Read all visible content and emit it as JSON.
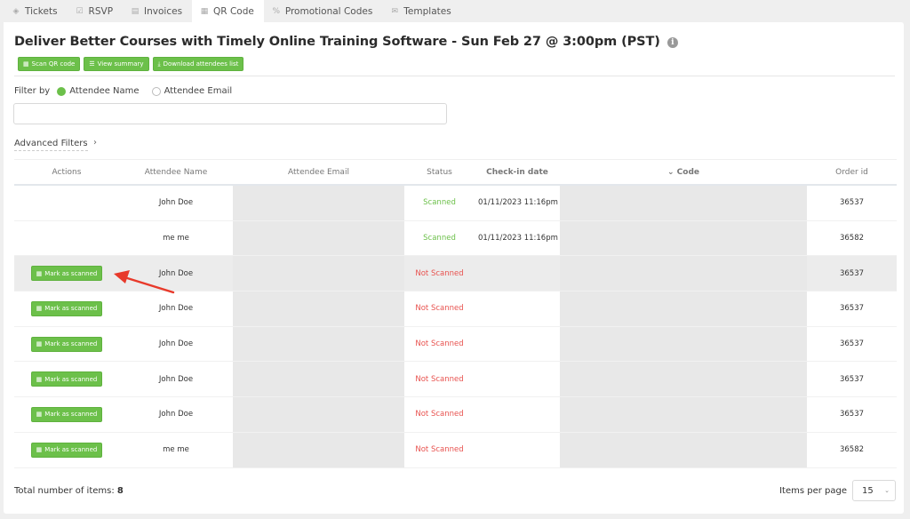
{
  "tabs": [
    {
      "label": "Tickets",
      "icon": "ticket-icon",
      "glyph": "◈",
      "active": false
    },
    {
      "label": "RSVP",
      "icon": "checkbox-icon",
      "glyph": "☑",
      "active": false
    },
    {
      "label": "Invoices",
      "icon": "document-icon",
      "glyph": "▤",
      "active": false
    },
    {
      "label": "QR Code",
      "icon": "qr-code-icon",
      "glyph": "▦",
      "active": true
    },
    {
      "label": "Promotional Codes",
      "icon": "percent-icon",
      "glyph": "%",
      "active": false
    },
    {
      "label": "Templates",
      "icon": "envelope-icon",
      "glyph": "✉",
      "active": false
    }
  ],
  "header": {
    "title": "Deliver Better Courses with Timely Online Training Software - Sun Feb 27 @ 3:00pm (PST)",
    "info_glyph": "i"
  },
  "toolbar": {
    "scan_label": "Scan QR code",
    "summary_label": "View summary",
    "download_label": "Download attendees list"
  },
  "filter": {
    "label": "Filter by",
    "options": [
      {
        "label": "Attendee Name",
        "selected": true
      },
      {
        "label": "Attendee Email",
        "selected": false
      }
    ],
    "search_value": "",
    "advanced_label": "Advanced Filters",
    "advanced_chevron": "›"
  },
  "table": {
    "columns": [
      "Actions",
      "Attendee Name",
      "Attendee Email",
      "Status",
      "Check-in date",
      "Code",
      "Order id"
    ],
    "sort_glyph": "⌄",
    "action_label": "Mark as scanned",
    "rows": [
      {
        "name": "John Doe",
        "email": "",
        "status": "Scanned",
        "checkin": "01/11/2023 11:16pm",
        "code": "",
        "order_id": "36537",
        "action": false,
        "highlight": false
      },
      {
        "name": "me me",
        "email": "",
        "status": "Scanned",
        "checkin": "01/11/2023 11:16pm",
        "code": "",
        "order_id": "36582",
        "action": false,
        "highlight": false
      },
      {
        "name": "John Doe",
        "email": "",
        "status": "Not Scanned",
        "checkin": "",
        "code": "",
        "order_id": "36537",
        "action": true,
        "highlight": true
      },
      {
        "name": "John Doe",
        "email": "",
        "status": "Not Scanned",
        "checkin": "",
        "code": "",
        "order_id": "36537",
        "action": true,
        "highlight": false
      },
      {
        "name": "John Doe",
        "email": "",
        "status": "Not Scanned",
        "checkin": "",
        "code": "",
        "order_id": "36537",
        "action": true,
        "highlight": false
      },
      {
        "name": "John Doe",
        "email": "",
        "status": "Not Scanned",
        "checkin": "",
        "code": "",
        "order_id": "36537",
        "action": true,
        "highlight": false
      },
      {
        "name": "John Doe",
        "email": "",
        "status": "Not Scanned",
        "checkin": "",
        "code": "",
        "order_id": "36537",
        "action": true,
        "highlight": false
      },
      {
        "name": "me me",
        "email": "",
        "status": "Not Scanned",
        "checkin": "",
        "code": "",
        "order_id": "36582",
        "action": true,
        "highlight": false
      }
    ]
  },
  "footer": {
    "total_label": "Total number of items:",
    "total_value": "8",
    "per_page_label": "Items per page",
    "per_page_value": "15"
  },
  "colors": {
    "accent_green": "#6cc04a",
    "scanned": "#6cc04a",
    "not_scanned": "#e8524f",
    "annotation_arrow": "#e8392a"
  }
}
